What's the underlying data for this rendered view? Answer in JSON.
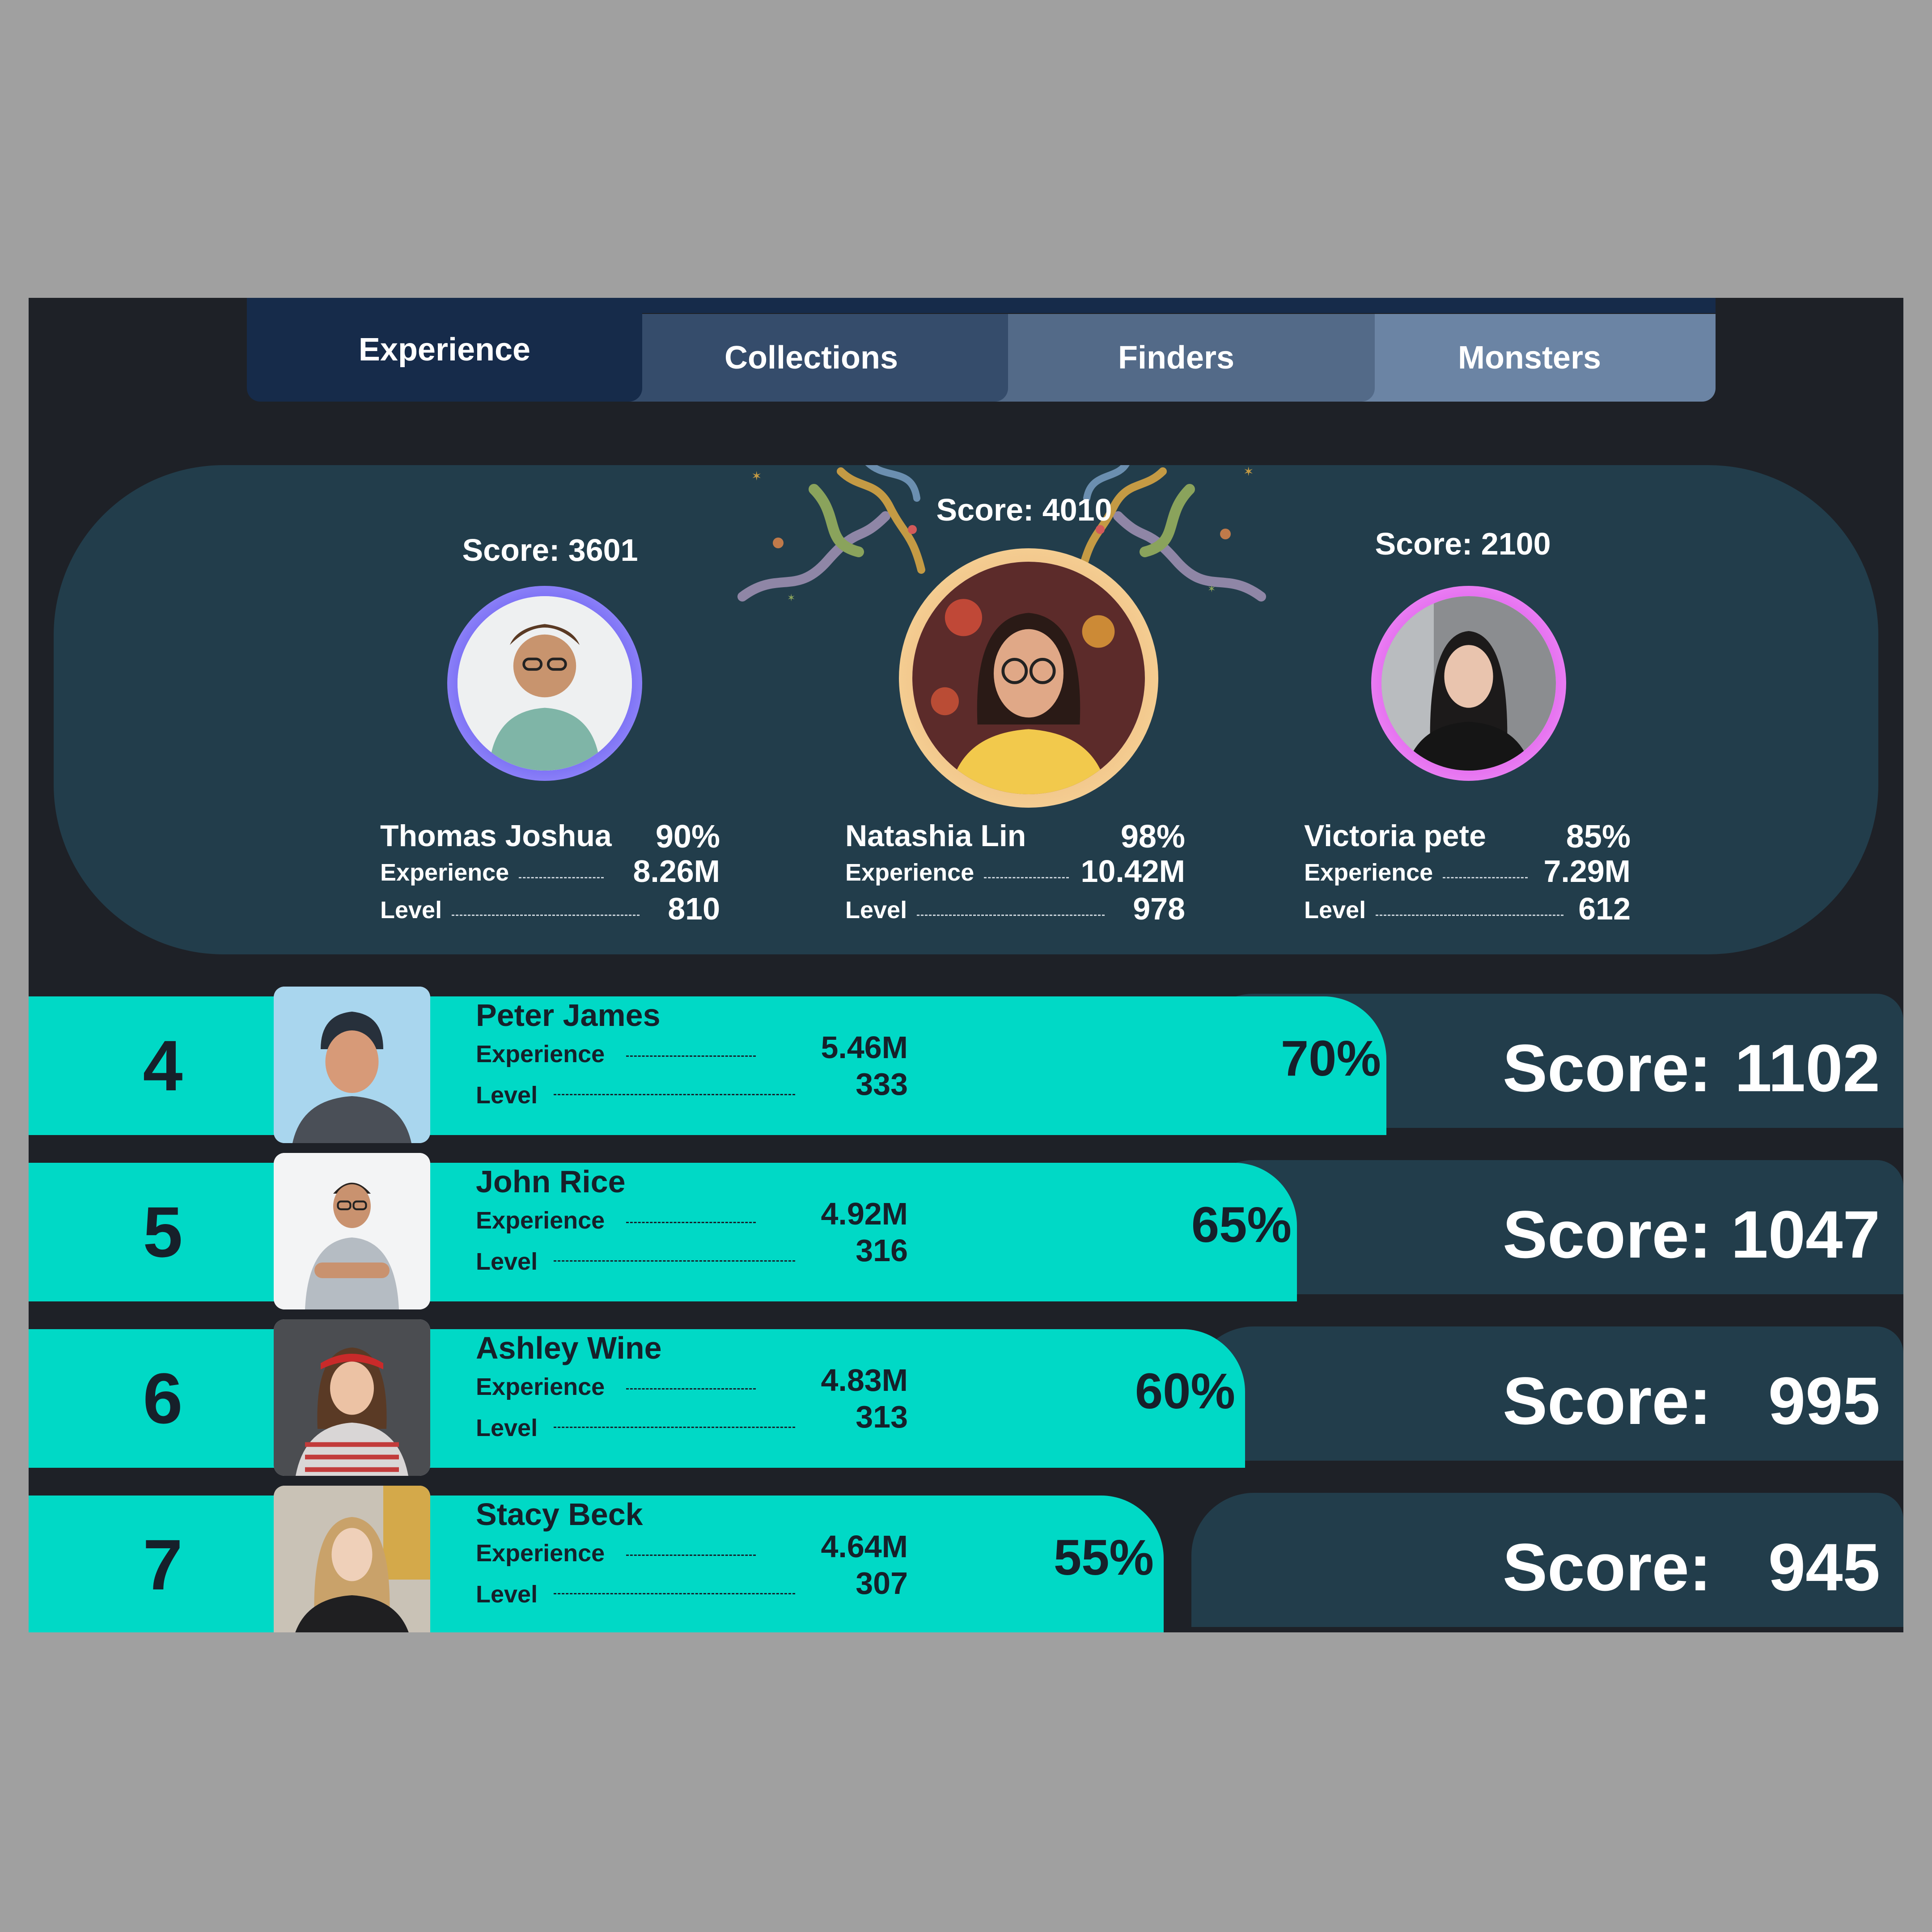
{
  "tabs": [
    {
      "label": "Experience",
      "active": true
    },
    {
      "label": "Collections",
      "active": false
    },
    {
      "label": "Finders",
      "active": false
    },
    {
      "label": "Monsters",
      "active": false
    }
  ],
  "podium": {
    "left": {
      "score": "Score: 3601",
      "name": "Thomas Joshua",
      "percent": "90%",
      "experience_label": "Experience",
      "experience": "8.26M",
      "level_label": "Level",
      "level": "810",
      "ring_color": "#7b70f5"
    },
    "center": {
      "score": "Score: 4010",
      "name": "Natashia Lin",
      "percent": "98%",
      "experience_label": "Experience",
      "experience": "10.42M",
      "level_label": "Level",
      "level": "978",
      "ring_color": "#f3c78c"
    },
    "right": {
      "score": "Score: 2100",
      "name": "Victoria pete",
      "percent": "85%",
      "experience_label": "Experience",
      "experience": "7.29M",
      "level_label": "Level",
      "level": "612",
      "ring_color": "#e56ef0"
    }
  },
  "ranks": [
    {
      "rank": "4",
      "name": "Peter James",
      "experience_label": "Experience",
      "experience": "5.46M",
      "level_label": "Level",
      "level": "333",
      "percent": "70%",
      "score_label": "Score:",
      "score": "1102"
    },
    {
      "rank": "5",
      "name": "John Rice",
      "experience_label": "Experience",
      "experience": "4.92M",
      "level_label": "Level",
      "level": "316",
      "percent": "65%",
      "score_label": "Score:",
      "score": "1047"
    },
    {
      "rank": "6",
      "name": "Ashley Wine",
      "experience_label": "Experience",
      "experience": "4.83M",
      "level_label": "Level",
      "level": "313",
      "percent": "60%",
      "score_label": "Score:",
      "score": "995"
    },
    {
      "rank": "7",
      "name": "Stacy Beck",
      "experience_label": "Experience",
      "experience": "4.64M",
      "level_label": "Level",
      "level": "307",
      "percent": "55%",
      "score_label": "Score:",
      "score": "945"
    }
  ],
  "colors": {
    "accent_bar": "#00d9c6",
    "panel": "#223d4b",
    "background": "#1e2127"
  }
}
